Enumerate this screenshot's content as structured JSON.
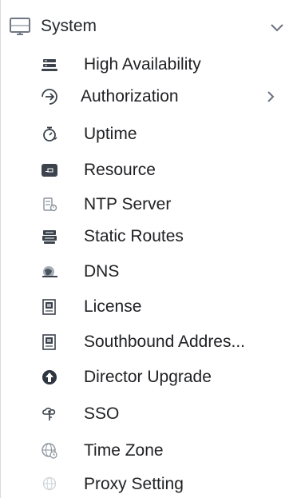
{
  "section": {
    "title": "System",
    "expanded": true
  },
  "menu": {
    "items": [
      {
        "label": "High Availability",
        "icon": "server-stack-icon"
      },
      {
        "label": "Authorization",
        "icon": "login-arrow-icon",
        "has_submenu": true
      },
      {
        "label": "Uptime",
        "icon": "stopwatch-icon"
      },
      {
        "label": "Resource",
        "icon": "resource-card-icon"
      },
      {
        "label": "NTP Server",
        "icon": "ntp-server-icon"
      },
      {
        "label": "Static Routes",
        "icon": "router-stack-icon"
      },
      {
        "label": "DNS",
        "icon": "dns-globe-icon"
      },
      {
        "label": "License",
        "icon": "license-document-icon"
      },
      {
        "label": "Southbound Addres...",
        "icon": "southbound-document-icon"
      },
      {
        "label": "Director Upgrade",
        "icon": "upgrade-arrow-icon"
      },
      {
        "label": "SSO",
        "icon": "sso-cloud-key-icon"
      },
      {
        "label": "Time Zone",
        "icon": "time-zone-globe-icon"
      },
      {
        "label": "Proxy Setting",
        "icon": "proxy-globe-icon"
      }
    ]
  },
  "colors": {
    "text": "#202124",
    "icon_dark": "#343b45",
    "icon_gray": "#7b8490",
    "icon_light": "#c7cdd4",
    "border": "#d7dbe0"
  }
}
